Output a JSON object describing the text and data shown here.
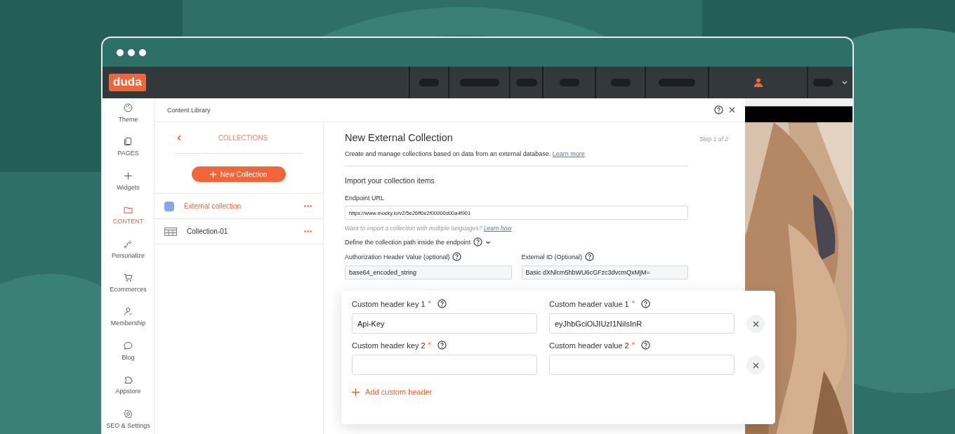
{
  "brand": "duda",
  "sidebar": {
    "items": [
      {
        "label": "Theme",
        "selected": false
      },
      {
        "label": "PAGES",
        "selected": false
      },
      {
        "label": "Widgets",
        "selected": false
      },
      {
        "label": "CONTENT",
        "selected": true
      },
      {
        "label": "Personalize",
        "selected": false
      },
      {
        "label": "Ecommerces",
        "selected": false
      },
      {
        "label": "Membership",
        "selected": false
      },
      {
        "label": "Blog",
        "selected": false
      },
      {
        "label": "Appstore",
        "selected": false
      },
      {
        "label": "SEO & Settings",
        "selected": false
      }
    ]
  },
  "panel_title": "Content Library",
  "library": {
    "back_label": "COLLECTIONS",
    "new_button": "New Collection",
    "collections": [
      {
        "name": "External collection",
        "kind": "external",
        "selected": true
      },
      {
        "name": "Collection-01",
        "kind": "table",
        "selected": false
      }
    ]
  },
  "dialog": {
    "title": "New External Collection",
    "step": "Step 1 of 2",
    "description": "Create and manage collections based on data from an external database.",
    "description_link": "Learn more",
    "section_title": "Import your collection items",
    "endpoint": {
      "label": "Endpoint URL",
      "value": "https://www.mocky.io/v2/5e26ff0e2f00000d00a4f901"
    },
    "hint": "Want to import a collection with multiple languages?",
    "hint_link": "Learn how",
    "path_label": "Define the collection path inside the endpoint",
    "auth": {
      "label": "Authorization Header Value (optional)",
      "value": "base64_encoded_string"
    },
    "external_id": {
      "label": "External ID (Optional)",
      "value": "Basic dXNlcm5hbWU6cGFzc3dvcmQxMjM="
    }
  },
  "custom_headers": {
    "rows": [
      {
        "key_label": "Custom header key 1",
        "key_value": "Api-Key",
        "value_label": "Custom header value 1",
        "value_value": "eyJhbGciOiJIUzI1NiIsInR",
        "required_mark": "*"
      },
      {
        "key_label": "Custom header key 2",
        "key_value": "",
        "value_label": "Custom header value 2",
        "value_value": "",
        "required_mark": "*"
      }
    ],
    "add_label": "Add custom header"
  }
}
